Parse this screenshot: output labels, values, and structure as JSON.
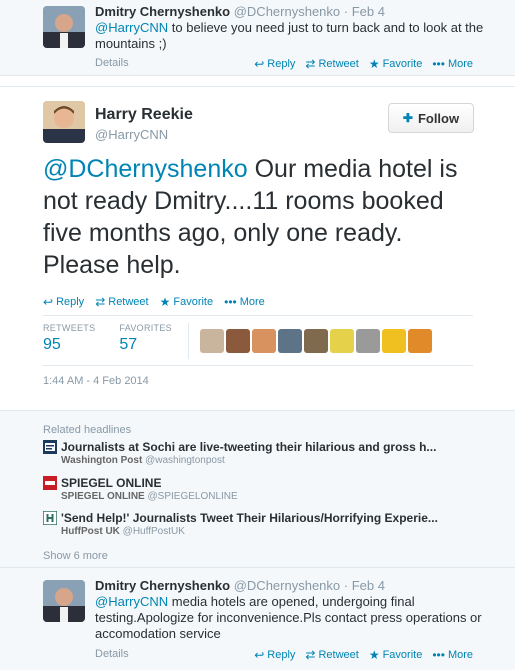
{
  "top_tweet": {
    "fullname": "Dmitry Chernyshenko",
    "handle": "@DChernyshenko",
    "dot": "·",
    "date": "Feb 4",
    "mention": "@HarryCNN",
    "text": "to believe you need just to turn back and to look at the mountains ;)",
    "details": "Details",
    "actions": {
      "reply": "Reply",
      "retweet": "Retweet",
      "favorite": "Favorite",
      "more": "More"
    }
  },
  "main_tweet": {
    "fullname": "Harry Reekie",
    "handle": "@HarryCNN",
    "follow_label": "Follow",
    "mention": "@DChernyshenko",
    "text": "Our media hotel is not ready Dmitry....11 rooms booked five months ago, only one ready. Please help.",
    "actions": {
      "reply": "Reply",
      "retweet": "Retweet",
      "favorite": "Favorite",
      "more": "More"
    },
    "stats": {
      "retweets_label": "RETWEETS",
      "retweets_value": "95",
      "favorites_label": "FAVORITES",
      "favorites_value": "57"
    },
    "timestamp": "1:44 AM - 4 Feb 2014"
  },
  "related": {
    "title": "Related headlines",
    "headlines": [
      {
        "title": "Journalists at Sochi are live-tweeting their hilarious and gross h...",
        "source": "Washington Post",
        "source_handle": "@washingtonpost"
      },
      {
        "title": "SPIEGEL ONLINE",
        "source": "SPIEGEL ONLINE",
        "source_handle": "@SPIEGELONLINE"
      },
      {
        "title": "'Send Help!' Journalists Tweet Their Hilarious/Horrifying Experie...",
        "source": "HuffPost UK",
        "source_handle": "@HuffPostUK"
      }
    ],
    "show_more": "Show 6 more"
  },
  "bottom_tweet": {
    "fullname": "Dmitry Chernyshenko",
    "handle": "@DChernyshenko",
    "dot": "·",
    "date": "Feb 4",
    "mention": "@HarryCNN",
    "text": "media hotels are opened, undergoing final testing.Apologize for inconvenience.Pls contact press operations or accomodation service",
    "details": "Details",
    "actions": {
      "reply": "Reply",
      "retweet": "Retweet",
      "favorite": "Favorite",
      "more": "More"
    }
  },
  "colors": {
    "link": "#0084b4",
    "muted": "#8899a6",
    "text": "#292f33",
    "panel": "#f5f8fa"
  }
}
